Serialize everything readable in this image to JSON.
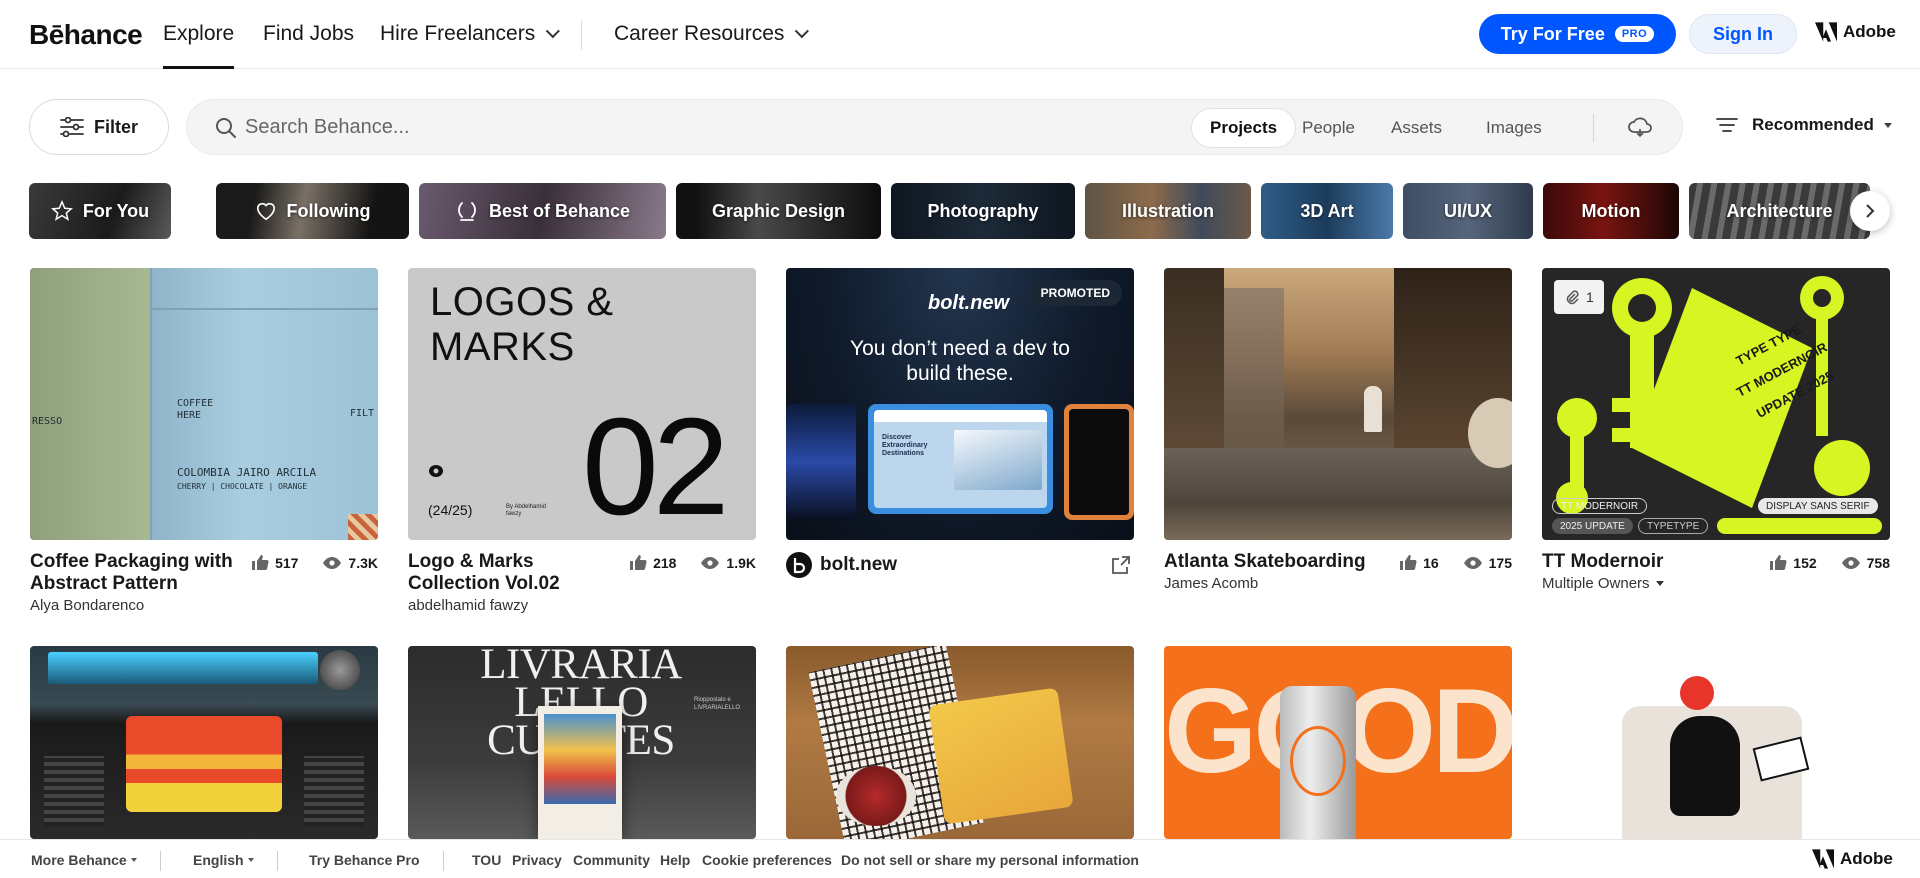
{
  "nav": {
    "logo": "Bēhance",
    "items": [
      {
        "label": "Explore",
        "active": true
      },
      {
        "label": "Find Jobs"
      },
      {
        "label": "Hire Freelancers",
        "dropdown": true
      },
      {
        "label": "Career Resources",
        "dropdown": true
      }
    ],
    "try_label": "Try For Free",
    "pro_badge": "PRO",
    "sign_in": "Sign In",
    "adobe": "Adobe"
  },
  "search": {
    "filter_label": "Filter",
    "placeholder": "Search Behance...",
    "tabs": [
      "Projects",
      "People",
      "Assets",
      "Images"
    ],
    "active_tab": "Projects",
    "sort_label": "Recommended"
  },
  "categories": [
    "For You",
    "Following",
    "Best of Behance",
    "Graphic Design",
    "Photography",
    "Illustration",
    "3D Art",
    "UI/UX",
    "Motion",
    "Architecture"
  ],
  "projects": [
    {
      "title": "Coffee Packaging with Abstract Pattern",
      "owner": "Alya Bondarenco",
      "likes": "517",
      "views": "7.3K"
    },
    {
      "title": "Logo & Marks Collection Vol.02",
      "owner": "abdelhamid fawzy",
      "likes": "218",
      "views": "1.9K"
    },
    {
      "title": "bolt.new",
      "promoted": "PROMOTED",
      "headline": "You don’t need a dev to build these."
    },
    {
      "title": "Atlanta Skateboarding",
      "owner": "James Acomb",
      "likes": "16",
      "views": "175"
    },
    {
      "title": "TT Modernoir",
      "owner": "Multiple Owners",
      "likes": "152",
      "views": "758",
      "attachments": "1"
    }
  ],
  "thumb_text": {
    "coffee_left": "RESSO",
    "coffee_brand": "COFFEE HERE",
    "coffee_name": "COLOMBIA JAIRO ARCILA",
    "coffee_notes": "CHERRY | CHOCOLATE | ORANGE",
    "coffee_right": "FILT",
    "logos_title": "LOGOS & MARKS",
    "logos_num": "02",
    "logos_count": "(24/25)",
    "logos_by": "By Abdelhamid fawzy",
    "bolt_logo": "bolt.new",
    "bolt_discover": "Discover Extraordinary Destinations",
    "tt_keytag_1": "TYPE TYPE",
    "tt_keytag_2": "TT MODERNOIR",
    "tt_keytag_3": "UPDATE 2025",
    "tt_label_1": "TT MODERNOIR",
    "tt_label_2": "2025 UPDATE",
    "tt_label_3": "TYPETYPE",
    "tt_label_4": "DISPLAY SANS SERIF",
    "lello_title": "LIVRARIA LELLO CURATES",
    "lello_side": "Rioppostalo e LIVRARIALELLO",
    "good_word": "GOOD"
  },
  "footer": {
    "items": [
      "More Behance",
      "English",
      "Try Behance Pro",
      "TOU",
      "Privacy",
      "Community",
      "Help",
      "Cookie preferences",
      "Do not sell or share my personal information"
    ],
    "adobe": "Adobe"
  }
}
